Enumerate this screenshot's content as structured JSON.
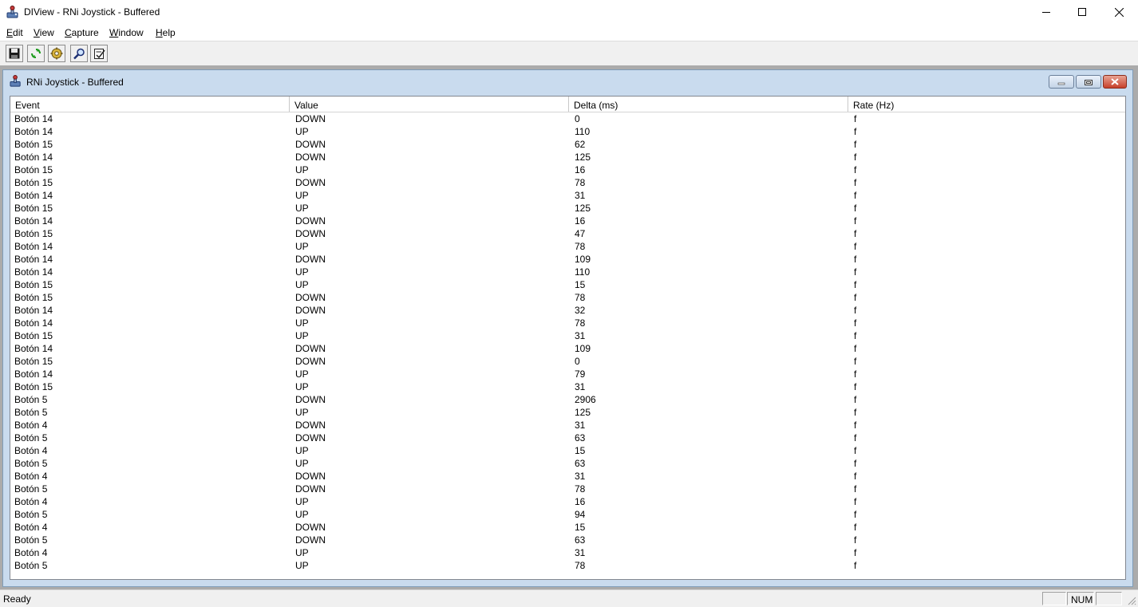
{
  "window": {
    "title": "DIView - RNi Joystick - Buffered"
  },
  "menu": [
    {
      "acc": "E",
      "rest": "dit"
    },
    {
      "acc": "V",
      "rest": "iew"
    },
    {
      "acc": "C",
      "rest": "apture"
    },
    {
      "acc": "W",
      "rest": "indow"
    },
    {
      "acc": "H",
      "rest": "elp"
    }
  ],
  "toolbar": {
    "buttons": [
      "save-icon",
      "refresh-icon",
      "settings-icon",
      "find-icon",
      "properties-icon"
    ]
  },
  "child": {
    "title": "RNi Joystick - Buffered"
  },
  "list": {
    "columns": [
      "Event",
      "Value",
      "Delta (ms)",
      "Rate (Hz)"
    ],
    "rows": [
      [
        "Botón 14",
        "DOWN",
        "0",
        "f"
      ],
      [
        "Botón 14",
        "UP",
        "110",
        "f"
      ],
      [
        "Botón 15",
        "DOWN",
        "62",
        "f"
      ],
      [
        "Botón 14",
        "DOWN",
        "125",
        "f"
      ],
      [
        "Botón 15",
        "UP",
        "16",
        "f"
      ],
      [
        "Botón 15",
        "DOWN",
        "78",
        "f"
      ],
      [
        "Botón 14",
        "UP",
        "31",
        "f"
      ],
      [
        "Botón 15",
        "UP",
        "125",
        "f"
      ],
      [
        "Botón 14",
        "DOWN",
        "16",
        "f"
      ],
      [
        "Botón 15",
        "DOWN",
        "47",
        "f"
      ],
      [
        "Botón 14",
        "UP",
        "78",
        "f"
      ],
      [
        "Botón 14",
        "DOWN",
        "109",
        "f"
      ],
      [
        "Botón 14",
        "UP",
        "110",
        "f"
      ],
      [
        "Botón 15",
        "UP",
        "15",
        "f"
      ],
      [
        "Botón 15",
        "DOWN",
        "78",
        "f"
      ],
      [
        "Botón 14",
        "DOWN",
        "32",
        "f"
      ],
      [
        "Botón 14",
        "UP",
        "78",
        "f"
      ],
      [
        "Botón 15",
        "UP",
        "31",
        "f"
      ],
      [
        "Botón 14",
        "DOWN",
        "109",
        "f"
      ],
      [
        "Botón 15",
        "DOWN",
        "0",
        "f"
      ],
      [
        "Botón 14",
        "UP",
        "79",
        "f"
      ],
      [
        "Botón 15",
        "UP",
        "31",
        "f"
      ],
      [
        "Botón 5",
        "DOWN",
        "2906",
        "f"
      ],
      [
        "Botón 5",
        "UP",
        "125",
        "f"
      ],
      [
        "Botón 4",
        "DOWN",
        "31",
        "f"
      ],
      [
        "Botón 5",
        "DOWN",
        "63",
        "f"
      ],
      [
        "Botón 4",
        "UP",
        "15",
        "f"
      ],
      [
        "Botón 5",
        "UP",
        "63",
        "f"
      ],
      [
        "Botón 4",
        "DOWN",
        "31",
        "f"
      ],
      [
        "Botón 5",
        "DOWN",
        "78",
        "f"
      ],
      [
        "Botón 4",
        "UP",
        "16",
        "f"
      ],
      [
        "Botón 5",
        "UP",
        "94",
        "f"
      ],
      [
        "Botón 4",
        "DOWN",
        "15",
        "f"
      ],
      [
        "Botón 5",
        "DOWN",
        "63",
        "f"
      ],
      [
        "Botón 4",
        "UP",
        "31",
        "f"
      ],
      [
        "Botón 5",
        "UP",
        "78",
        "f"
      ]
    ]
  },
  "status": {
    "text": "Ready",
    "pane2": "NUM"
  }
}
